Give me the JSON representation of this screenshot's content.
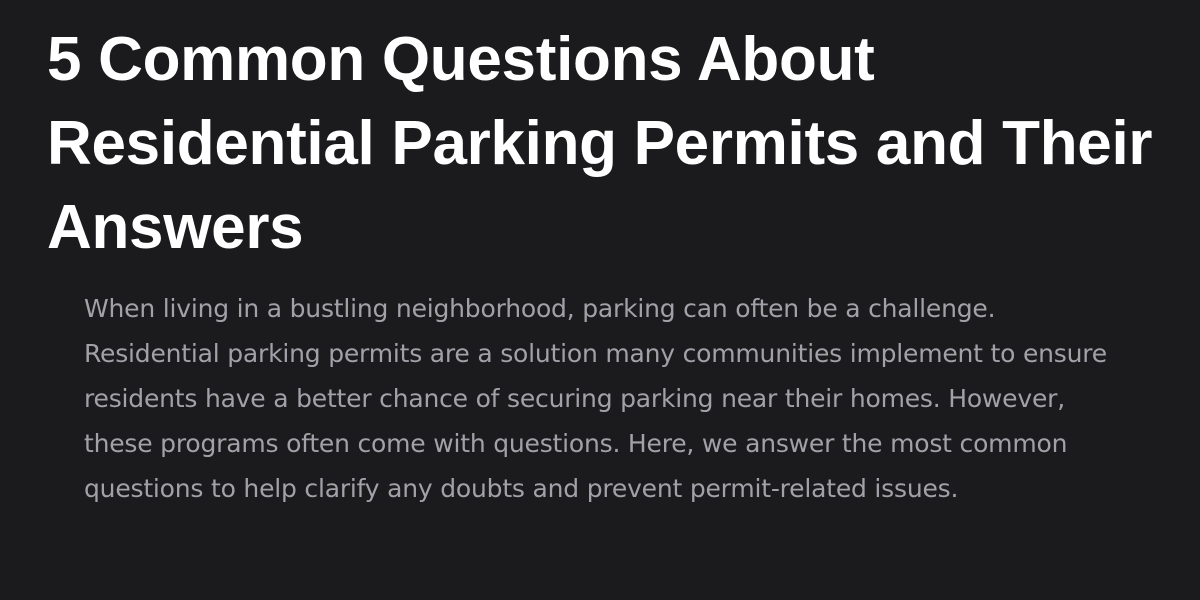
{
  "article": {
    "title": "5 Common Questions About Residential Parking Permits and Their Answers",
    "intro": "When living in a bustling neighborhood, parking can often be a challenge. Residential parking permits are a solution many communities implement to ensure residents have a better chance of securing parking near their homes. However, these programs often come with questions. Here, we answer the most common questions to help clarify any doubts and prevent permit-related issues."
  },
  "colors": {
    "background": "#1b1b1d",
    "title": "#ffffff",
    "body_text": "#a3a1a8"
  }
}
